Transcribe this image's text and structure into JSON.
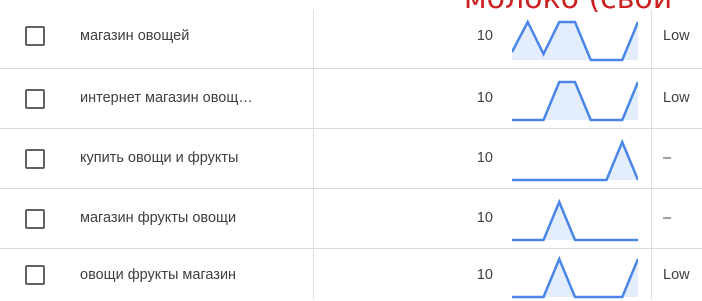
{
  "overlay_text": "молоко (свои",
  "rows": [
    {
      "keyword": "магазин овощей",
      "volume": "10",
      "competition": "Low",
      "trend": [
        0.2,
        0.95,
        0.15,
        0.95,
        0.95,
        0.0,
        0.0,
        0.0,
        0.95
      ]
    },
    {
      "keyword": "интернет магазин овощ…",
      "volume": "10",
      "competition": "Low",
      "trend": [
        0.0,
        0.0,
        0.0,
        0.95,
        0.95,
        0.0,
        0.0,
        0.0,
        0.95
      ]
    },
    {
      "keyword": "купить овощи и фрукты",
      "volume": "10",
      "competition": "–",
      "trend": [
        0.0,
        0.0,
        0.0,
        0.0,
        0.0,
        0.0,
        0.0,
        0.95,
        0.0
      ]
    },
    {
      "keyword": "магазин фрукты овощи",
      "volume": "10",
      "competition": "–",
      "trend": [
        0.0,
        0.0,
        0.0,
        0.95,
        0.0,
        0.0,
        0.0,
        0.0,
        0.0
      ]
    },
    {
      "keyword": "овощи фрукты магазин",
      "volume": "10",
      "competition": "Low",
      "trend": [
        0.0,
        0.0,
        0.0,
        0.95,
        0.0,
        0.0,
        0.0,
        0.0,
        0.95
      ]
    }
  ],
  "colors": {
    "trend_line": "#4a86e8",
    "trend_fill": "#e3edfb",
    "overlay": "#cc1f1f"
  }
}
